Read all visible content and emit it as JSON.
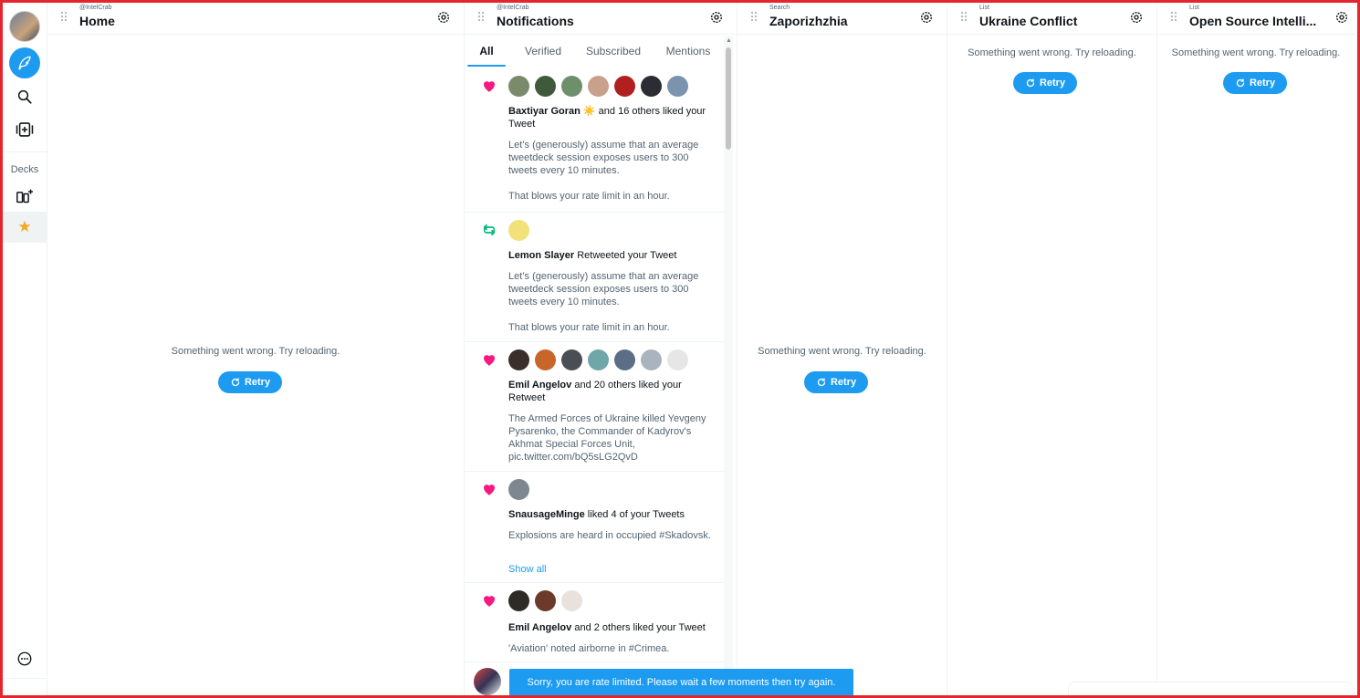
{
  "sidebar": {
    "decks_label": "Decks"
  },
  "columns": {
    "home": {
      "sub": "@IntelCrab",
      "title": "Home",
      "error": "Something went wrong. Try reloading.",
      "retry": "Retry"
    },
    "notifications": {
      "sub": "@IntelCrab",
      "title": "Notifications",
      "tabs": [
        "All",
        "Verified",
        "Subscribed",
        "Mentions"
      ],
      "items": [
        {
          "type": "like",
          "avatars": 7,
          "name": "Baxtiyar Goran ☀️",
          "action": " and 16 others liked your Tweet",
          "body": [
            "Let’s (generously) assume that an average tweetdeck session exposes users to 300 tweets every 10 minutes.",
            "That blows your rate limit in an hour."
          ]
        },
        {
          "type": "retweet",
          "avatars": 1,
          "name": "Lemon Slayer",
          "action": " Retweeted your Tweet",
          "body": [
            "Let’s (generously) assume that an average tweetdeck session exposes users to 300 tweets every 10 minutes.",
            "That blows your rate limit in an hour."
          ]
        },
        {
          "type": "like",
          "avatars": 7,
          "name": "Emil Angelov",
          "action": " and 20 others liked your Retweet",
          "body": [
            "The Armed Forces of Ukraine killed Yevgeny Pysarenko, the Commander of Kadyrov's Akhmat Special Forces Unit, pic.twitter.com/bQ5sLG2QvD"
          ]
        },
        {
          "type": "like",
          "avatars": 1,
          "name": "SnausageMinge",
          "action": " liked 4 of your Tweets",
          "body": [
            "Explosions are heard in occupied #Skadovsk."
          ],
          "link": "Show all"
        },
        {
          "type": "like",
          "avatars": 3,
          "name": "Emil Angelov",
          "action": " and 2 others liked your Tweet",
          "body": [
            "'Aviation' noted airborne in #Crimea."
          ]
        }
      ]
    },
    "search": {
      "sub": "Search",
      "title": "Zaporizhzhia",
      "error": "Something went wrong. Try reloading.",
      "retry": "Retry"
    },
    "list1": {
      "sub": "List",
      "title": "Ukraine Conflict",
      "error": "Something went wrong. Try reloading.",
      "retry": "Retry"
    },
    "list2": {
      "sub": "List",
      "title": "Open Source Intelli...",
      "error": "Something went wrong. Try reloading.",
      "retry": "Retry"
    }
  },
  "toast": {
    "message": "Sorry, you are rate limited. Please wait a few moments then try again."
  },
  "colors": {
    "accent": "#1d9bf0",
    "like": "#f91880",
    "retweet": "#00ba7c",
    "frame": "#e3262e"
  }
}
